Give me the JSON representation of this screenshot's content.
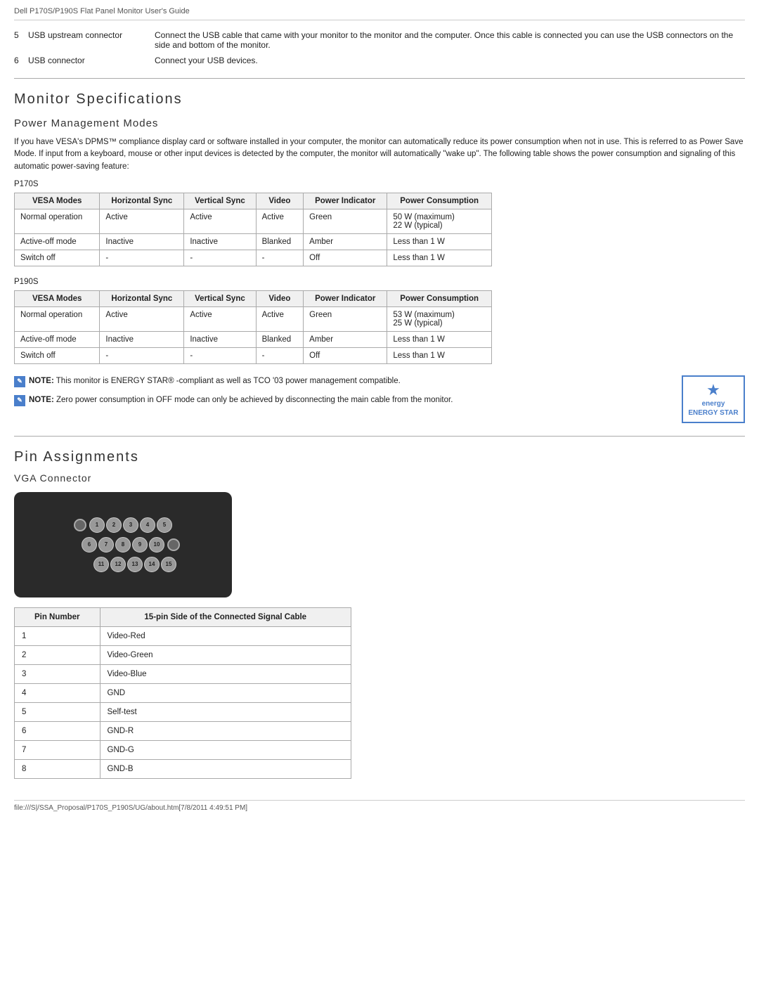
{
  "header": {
    "title": "Dell P170S/P190S Flat Panel Monitor User's Guide"
  },
  "usb_section": {
    "items": [
      {
        "num": "5",
        "label": "USB upstream connector",
        "description": "Connect the USB cable that came with your monitor to the monitor and the computer. Once this cable is connected you can use the USB connectors on the side and bottom of the monitor."
      },
      {
        "num": "6",
        "label": "USB connector",
        "description": "Connect your USB devices."
      }
    ]
  },
  "monitor_specs": {
    "section_title": "Monitor Specifications",
    "power_management": {
      "subsection_title": "Power Management Modes",
      "intro": "If you have VESA's DPMS™ compliance display card or software installed in your computer, the monitor can automatically reduce its power consumption when not in use. This is referred to as Power Save Mode. If input from a keyboard, mouse or other input devices is detected by the computer, the monitor will automatically \"wake up\". The following table shows the power consumption and signaling of this automatic power-saving feature:",
      "p170s_label": "P170S",
      "p190s_label": "P190S",
      "table_headers": [
        "VESA Modes",
        "Horizontal Sync",
        "Vertical Sync",
        "Video",
        "Power Indicator",
        "Power Consumption"
      ],
      "p170s_rows": [
        {
          "mode": "Normal operation",
          "h_sync": "Active",
          "v_sync": "Active",
          "video": "Active",
          "indicator": "Green",
          "consumption": "50 W (maximum)\n22 W (typical)"
        },
        {
          "mode": "Active-off mode",
          "h_sync": "Inactive",
          "v_sync": "Inactive",
          "video": "Blanked",
          "indicator": "Amber",
          "consumption": "Less than 1 W"
        },
        {
          "mode": "Switch off",
          "h_sync": "-",
          "v_sync": "-",
          "video": "-",
          "indicator": "Off",
          "consumption": "Less than 1 W"
        }
      ],
      "p190s_rows": [
        {
          "mode": "Normal operation",
          "h_sync": "Active",
          "v_sync": "Active",
          "video": "Active",
          "indicator": "Green",
          "consumption": "53 W (maximum)\n25 W (typical)"
        },
        {
          "mode": "Active-off mode",
          "h_sync": "Inactive",
          "v_sync": "Inactive",
          "video": "Blanked",
          "indicator": "Amber",
          "consumption": "Less than 1 W"
        },
        {
          "mode": "Switch off",
          "h_sync": "-",
          "v_sync": "-",
          "video": "-",
          "indicator": "Off",
          "consumption": "Less than 1 W"
        }
      ]
    },
    "notes": [
      {
        "label": "NOTE:",
        "text": "This monitor is ENERGY STAR® -compliant as well as TCO '03 power management compatible."
      },
      {
        "label": "NOTE:",
        "text": "Zero power consumption in OFF mode can only be achieved by disconnecting the main cable from the monitor."
      }
    ],
    "energy_star": {
      "label": "energy",
      "sublabel": "ENERGY STAR"
    }
  },
  "pin_assignments": {
    "section_title": "Pin Assignments",
    "vga_connector": {
      "subsection_title": "VGA Connector",
      "pin_rows": [
        [
          "1",
          "2",
          "3",
          "4",
          "5"
        ],
        [
          "6",
          "7",
          "8",
          "9",
          "10"
        ],
        [
          "11",
          "12",
          "13",
          "14",
          "15"
        ]
      ],
      "table_headers": [
        "Pin Number",
        "15-pin Side of the Connected Signal Cable"
      ],
      "pins": [
        {
          "num": "1",
          "signal": "Video-Red"
        },
        {
          "num": "2",
          "signal": "Video-Green"
        },
        {
          "num": "3",
          "signal": "Video-Blue"
        },
        {
          "num": "4",
          "signal": "GND"
        },
        {
          "num": "5",
          "signal": "Self-test"
        },
        {
          "num": "6",
          "signal": "GND-R"
        },
        {
          "num": "7",
          "signal": "GND-G"
        },
        {
          "num": "8",
          "signal": "GND-B"
        }
      ]
    }
  },
  "footer": {
    "text": "file:///S|/SSA_Proposal/P170S_P190S/UG/about.htm[7/8/2011 4:49:51 PM]"
  }
}
